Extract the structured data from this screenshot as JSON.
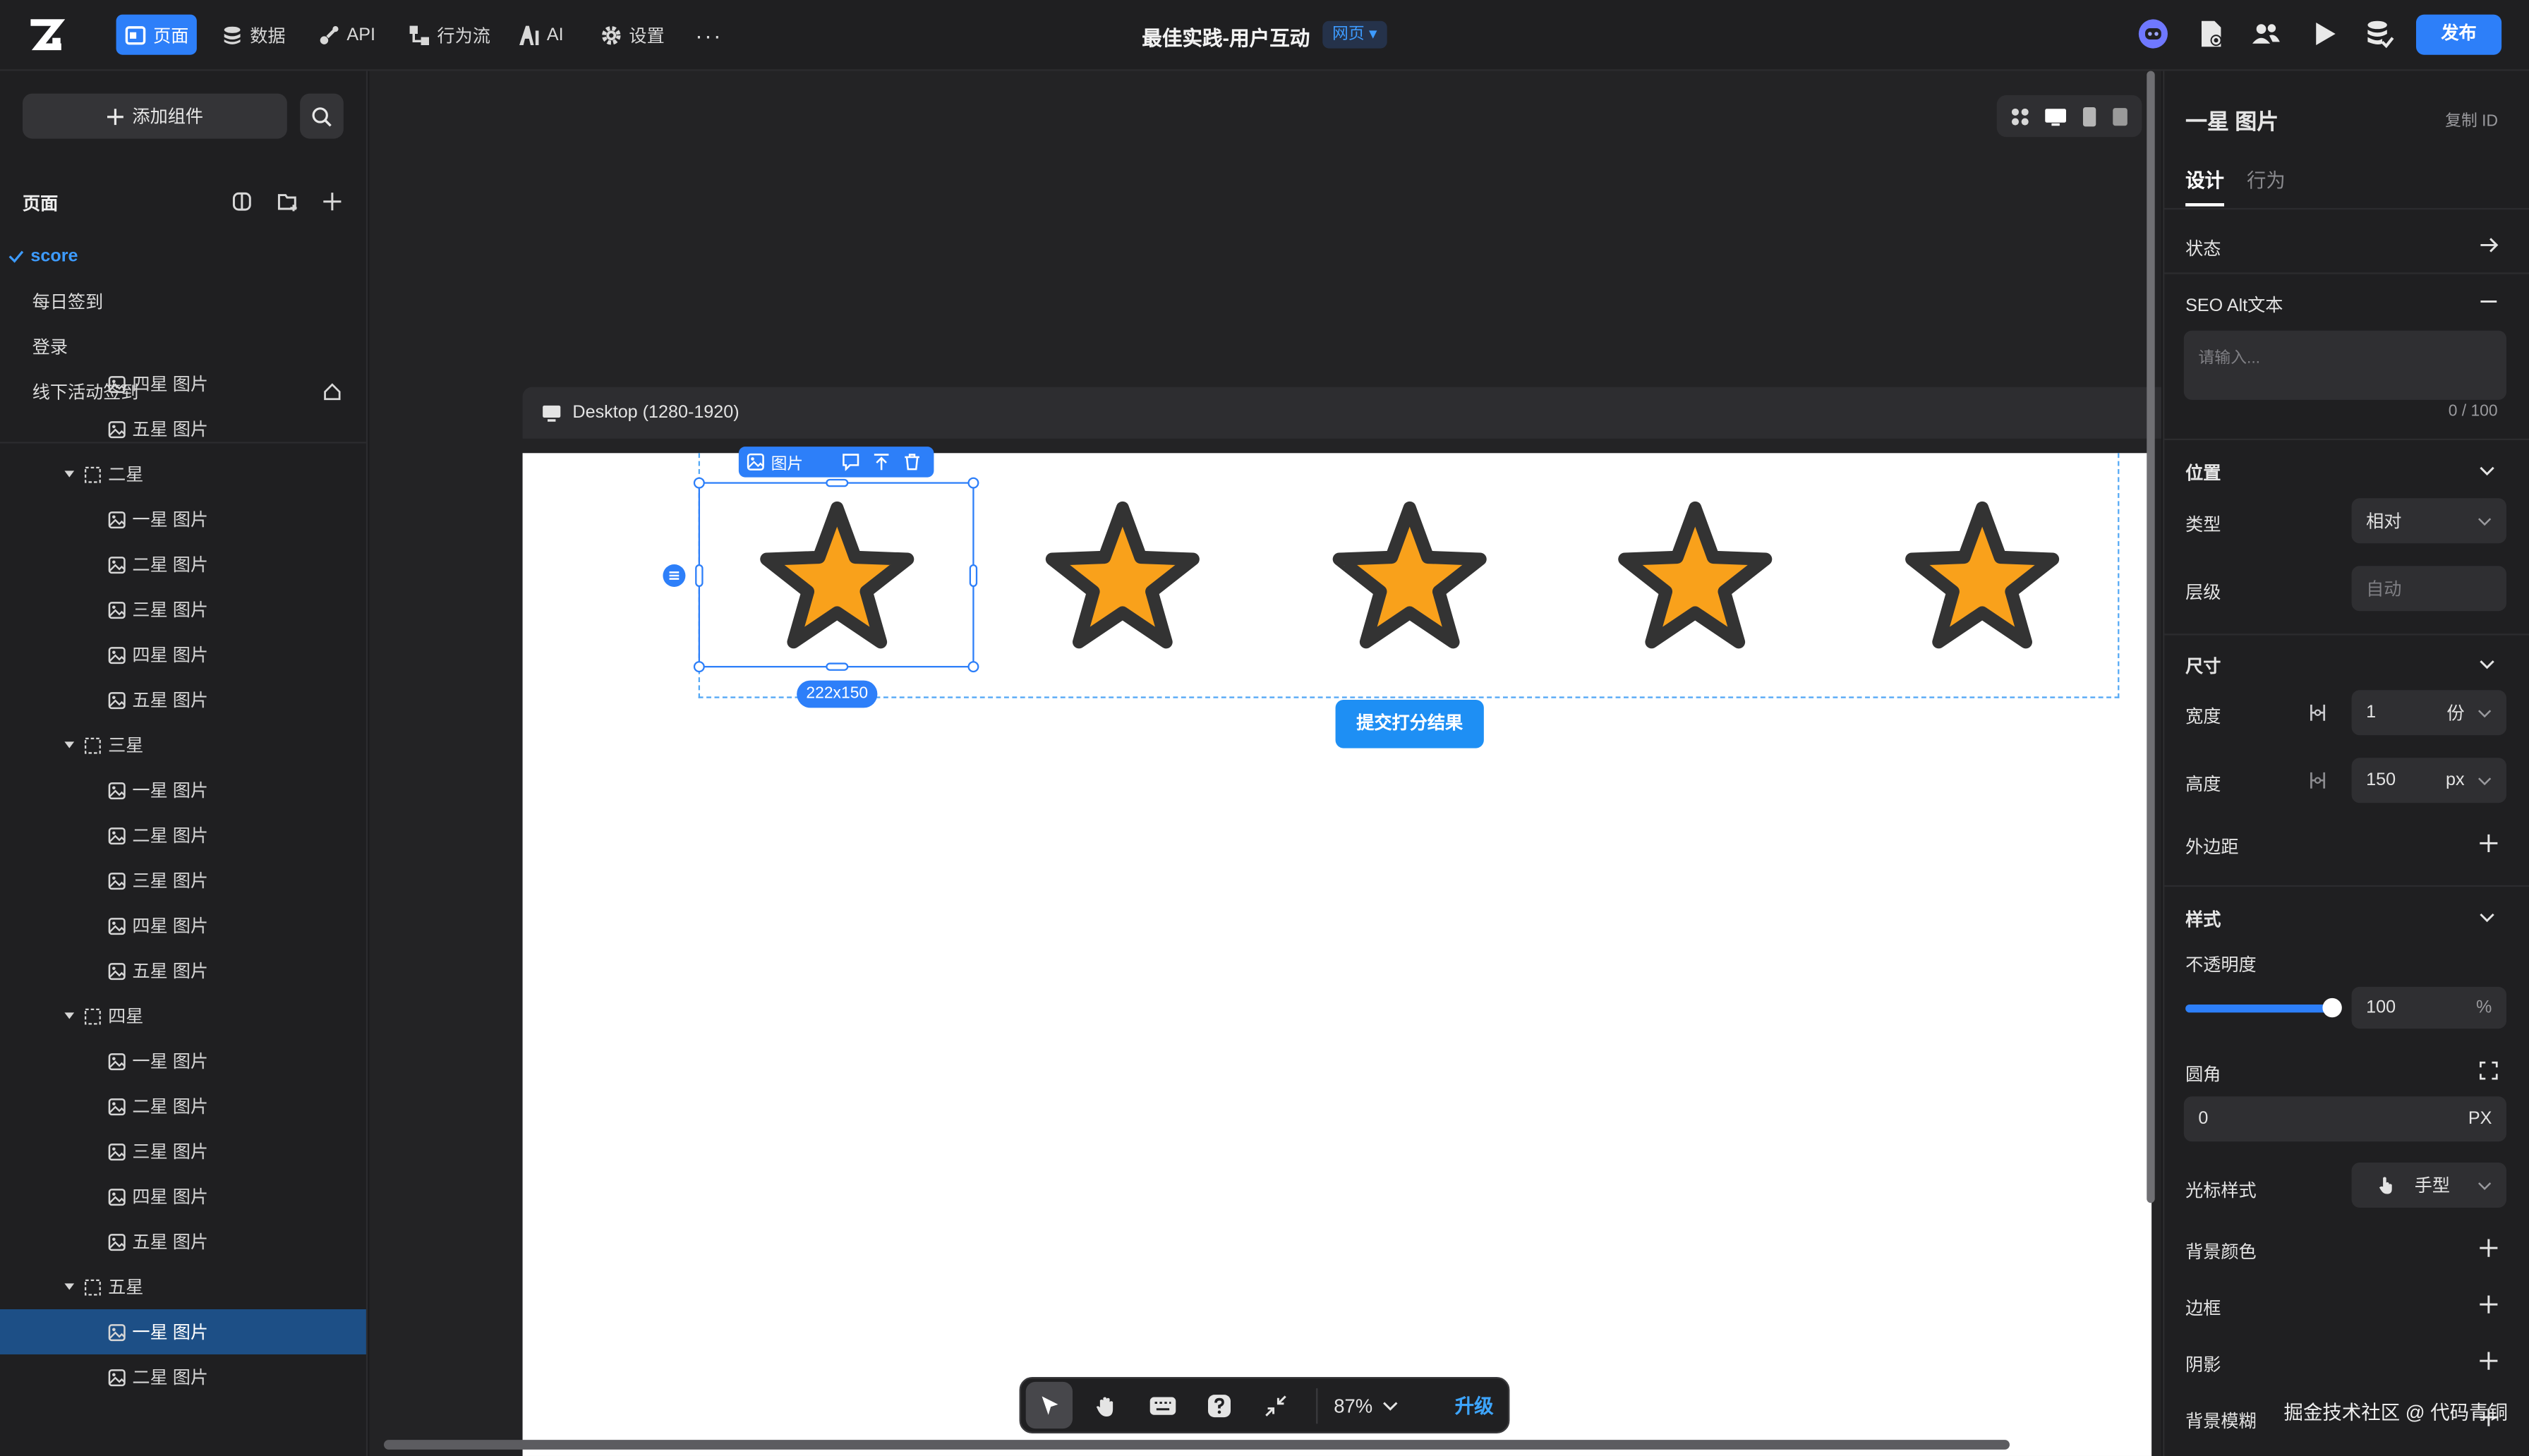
{
  "topbar": {
    "nav": [
      {
        "label": "页面",
        "icon": "page-icon",
        "active": true
      },
      {
        "label": "数据",
        "icon": "database-icon"
      },
      {
        "label": "API",
        "icon": "api-icon"
      },
      {
        "label": "行为流",
        "icon": "flow-icon"
      },
      {
        "label": "AI",
        "icon": "ai-icon"
      },
      {
        "label": "设置",
        "icon": "gear-icon"
      }
    ],
    "more": "···",
    "title": "最佳实践-用户互动",
    "badge": "网页",
    "publish": "发布"
  },
  "left": {
    "add_component": "添加组件",
    "pages_title": "页面",
    "pages": [
      {
        "label": "score",
        "selected": true
      },
      {
        "label": "每日签到"
      },
      {
        "label": "登录"
      },
      {
        "label": "线下活动签到",
        "home": true
      }
    ],
    "tree": [
      {
        "type": "image",
        "label": "四星 图片"
      },
      {
        "type": "image",
        "label": "五星 图片"
      },
      {
        "type": "group",
        "label": "二星"
      },
      {
        "type": "image",
        "label": "一星 图片"
      },
      {
        "type": "image",
        "label": "二星 图片"
      },
      {
        "type": "image",
        "label": "三星 图片"
      },
      {
        "type": "image",
        "label": "四星 图片"
      },
      {
        "type": "image",
        "label": "五星 图片"
      },
      {
        "type": "group",
        "label": "三星"
      },
      {
        "type": "image",
        "label": "一星 图片"
      },
      {
        "type": "image",
        "label": "二星 图片"
      },
      {
        "type": "image",
        "label": "三星 图片"
      },
      {
        "type": "image",
        "label": "四星 图片"
      },
      {
        "type": "image",
        "label": "五星 图片"
      },
      {
        "type": "group",
        "label": "四星"
      },
      {
        "type": "image",
        "label": "一星 图片"
      },
      {
        "type": "image",
        "label": "二星 图片"
      },
      {
        "type": "image",
        "label": "三星 图片"
      },
      {
        "type": "image",
        "label": "四星 图片"
      },
      {
        "type": "image",
        "label": "五星 图片"
      },
      {
        "type": "group",
        "label": "五星"
      },
      {
        "type": "image",
        "label": "一星 图片",
        "selected": true
      },
      {
        "type": "image",
        "label": "二星 图片"
      }
    ]
  },
  "canvas": {
    "device_label": "Desktop (1280-1920)",
    "selection_tag": "图片",
    "selection_size": "222x150",
    "submit": "提交打分结果",
    "zoom": "87%",
    "upgrade": "升级",
    "star_fill": "#F9A11B",
    "star_stroke": "#333333"
  },
  "right": {
    "title": "一星 图片",
    "copy_id": "复制 ID",
    "tabs": [
      "设计",
      "行为"
    ],
    "state": "状态",
    "seo_label": "SEO Alt文本",
    "seo_placeholder": "请输入...",
    "seo_count": "0 / 100",
    "position": "位置",
    "type_label": "类型",
    "type_value": "相对",
    "layer_label": "层级",
    "layer_placeholder": "自动",
    "size": "尺寸",
    "width_label": "宽度",
    "width_value": "1",
    "width_unit": "份",
    "height_label": "高度",
    "height_value": "150",
    "height_unit": "px",
    "margin": "外边距",
    "style": "样式",
    "opacity_label": "不透明度",
    "opacity_value": "100",
    "opacity_unit": "%",
    "radius_label": "圆角",
    "radius_value": "0",
    "radius_unit": "PX",
    "cursor_label": "光标样式",
    "cursor_value": "手型",
    "bg_color": "背景颜色",
    "border": "边框",
    "shadow": "阴影",
    "bg_blur": "背景模糊",
    "watermark": "掘金技术社区 @ 代码青铜"
  }
}
